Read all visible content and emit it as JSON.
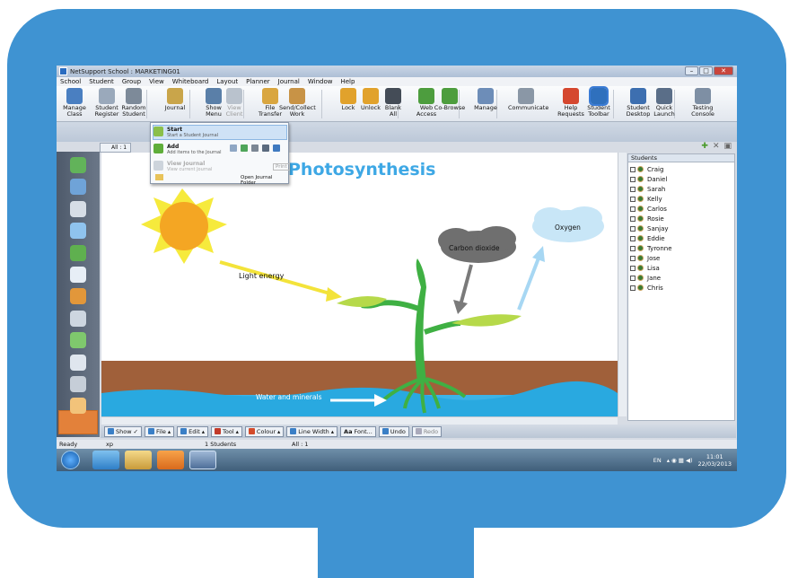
{
  "window": {
    "title": "NetSupport School : MARKETING01"
  },
  "menu": [
    "School",
    "Student",
    "Group",
    "View",
    "Whiteboard",
    "Layout",
    "Planner",
    "Journal",
    "Window",
    "Help"
  ],
  "toolbar": [
    {
      "label": "Manage\nClass",
      "icon": "manage-class-icon",
      "color": "#4a7fc1"
    },
    {
      "label": "Student\nRegister",
      "icon": "student-register-icon",
      "color": "#9aa9bb"
    },
    {
      "label": "Random\nStudent",
      "icon": "random-student-icon",
      "color": "#7d8a99"
    },
    {
      "label": "Journal",
      "icon": "journal-icon",
      "color": "#c9a54a"
    },
    {
      "label": "Show\nMenu",
      "icon": "show-menu-icon",
      "color": "#5a7fa8"
    },
    {
      "label": "View\nClient",
      "icon": "view-client-icon",
      "color": "#b9c2cd"
    },
    {
      "label": "File\nTransfer",
      "icon": "file-transfer-icon",
      "color": "#d9a640"
    },
    {
      "label": "Send/Collect\nWork",
      "icon": "send-collect-icon",
      "color": "#c89346"
    },
    {
      "label": "Lock",
      "icon": "lock-icon",
      "color": "#e1a22c"
    },
    {
      "label": "Unlock",
      "icon": "unlock-icon",
      "color": "#e1a22c"
    },
    {
      "label": "Blank\nAll",
      "icon": "blank-all-icon",
      "color": "#444c57"
    },
    {
      "label": "Web\nAccess",
      "icon": "web-access-icon",
      "color": "#4d9d3e"
    },
    {
      "label": "Co-Browse",
      "icon": "co-browse-icon",
      "color": "#4d9d3e"
    },
    {
      "label": "Manage",
      "icon": "manage-icon",
      "color": "#6d8db8"
    },
    {
      "label": "Communicate",
      "icon": "communicate-icon",
      "color": "#8a97a6"
    },
    {
      "label": "Help\nRequests",
      "icon": "help-requests-icon",
      "color": "#d5472f"
    },
    {
      "label": "Student\nToolbar",
      "icon": "student-toolbar-icon",
      "color": "#2f70bd"
    },
    {
      "label": "Student\nDesktop",
      "icon": "student-desktop-icon",
      "color": "#3d6fb0"
    },
    {
      "label": "Quick\nLaunch",
      "icon": "quick-launch-icon",
      "color": "#5a6e88"
    },
    {
      "label": "Testing\nConsole",
      "icon": "testing-console-icon",
      "color": "#7e8fa4"
    }
  ],
  "journal_menu": {
    "start_title": "Start",
    "start_sub": "Start a Student Journal",
    "add_title": "Add",
    "add_sub": "Add items to the Journal",
    "view_title": "View Journal",
    "view_sub": "View current Journal",
    "print": "Print",
    "open_folder": "Open Journal Folder"
  },
  "tab": {
    "label": "All : 1"
  },
  "whiteboard": {
    "title": "Photosynthesis",
    "light": "Light energy",
    "co2": "Carbon dioxide",
    "oxygen": "Oxygen",
    "water": "Water and minerals"
  },
  "students": {
    "header": "Students",
    "names": [
      "Craig",
      "Daniel",
      "Sarah",
      "Kelly",
      "Carlos",
      "Rosie",
      "Sanjay",
      "Eddie",
      "Tyronne",
      "Jose",
      "Lisa",
      "Jane",
      "Chris"
    ]
  },
  "bottom_toolbar": {
    "show": "Show",
    "file": "File",
    "edit": "Edit",
    "tool": "Tool",
    "colour": "Colour",
    "line_width": "Line Width",
    "font": "Font...",
    "undo": "Undo",
    "redo": "Redo"
  },
  "status": {
    "ready": "Ready",
    "xp": "xp",
    "students": "1 Students",
    "all": "All : 1"
  },
  "taskbar": {
    "lang": "EN",
    "time": "11:01",
    "date": "22/03/2013"
  },
  "colors": {
    "bezel": "#3f93d2",
    "highlight": "#e3813a"
  }
}
